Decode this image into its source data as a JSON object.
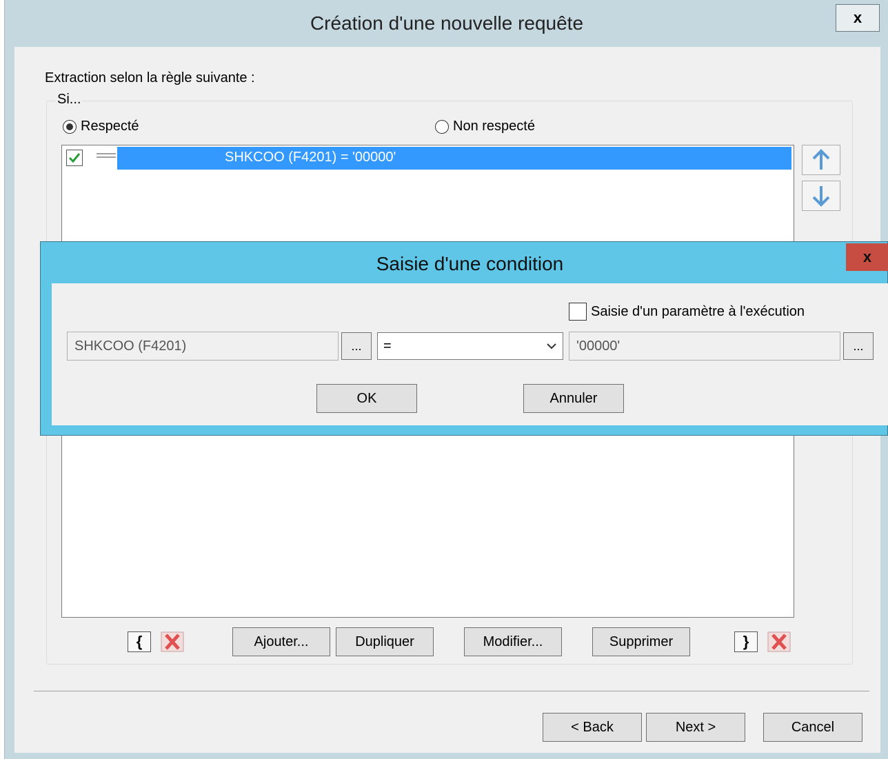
{
  "main": {
    "title": "Création d'une nouvelle requête",
    "close": "x",
    "extraction_label": "Extraction selon la règle suivante :",
    "group_caption": "Si...",
    "radio_respected": "Respecté",
    "radio_not_respected": "Non respecté",
    "rule_row": {
      "checked": true,
      "text": "SHKCOO (F4201) = '00000'"
    },
    "buttons": {
      "add": "Ajouter...",
      "duplicate": "Dupliquer",
      "modify": "Modifier...",
      "delete": "Supprimer"
    },
    "open_brace": "{",
    "close_brace": "}",
    "footer": {
      "back": "< Back",
      "next": "Next >",
      "cancel": "Cancel"
    }
  },
  "dialog": {
    "title": "Saisie d'une condition",
    "close": "x",
    "param_checkbox_label": "Saisie d'un paramètre à l'exécution",
    "field_value": "SHKCOO (F4201)",
    "ellipsis": "...",
    "operator_value": "=",
    "compare_value": "'00000'",
    "ok": "OK",
    "cancel": "Annuler"
  },
  "icons": [
    "arrow-up-icon",
    "arrow-down-icon",
    "check-icon",
    "red-x-icon",
    "chevron-down-icon"
  ],
  "colors": {
    "selection": "#3399ff",
    "dialog_frame": "#60c6e8",
    "dialog_close": "#c74d43"
  }
}
